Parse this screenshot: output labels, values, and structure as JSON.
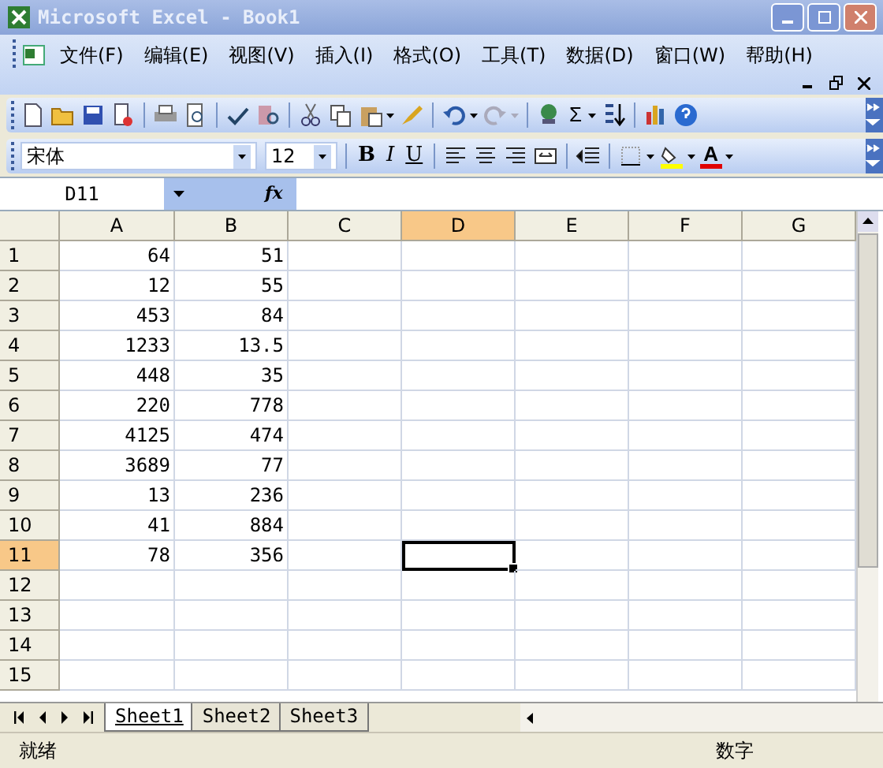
{
  "window": {
    "title": "Microsoft Excel - Book1"
  },
  "menu": [
    "文件(F)",
    "编辑(E)",
    "视图(V)",
    "插入(I)",
    "格式(O)",
    "工具(T)",
    "数据(D)",
    "窗口(W)",
    "帮助(H)"
  ],
  "toolbar": {
    "autosum": "Σ"
  },
  "format_toolbar": {
    "font": "宋体",
    "size": "12",
    "bold": "B",
    "italic": "I",
    "underline": "U",
    "font_color": "A"
  },
  "formula_bar": {
    "name_box": "D11",
    "fx": "fx"
  },
  "sheet": {
    "columns": [
      {
        "label": "A",
        "selected": false
      },
      {
        "label": "B",
        "selected": false
      },
      {
        "label": "C",
        "selected": false
      },
      {
        "label": "D",
        "selected": true
      },
      {
        "label": "E",
        "selected": false
      },
      {
        "label": "F",
        "selected": false
      },
      {
        "label": "G",
        "selected": false
      }
    ],
    "rows": [
      {
        "label": "1",
        "selected": false,
        "cells": [
          "64",
          "51"
        ]
      },
      {
        "label": "2",
        "selected": false,
        "cells": [
          "12",
          "55"
        ]
      },
      {
        "label": "3",
        "selected": false,
        "cells": [
          "453",
          "84"
        ]
      },
      {
        "label": "4",
        "selected": false,
        "cells": [
          "1233",
          "13.5"
        ]
      },
      {
        "label": "5",
        "selected": false,
        "cells": [
          "448",
          "35"
        ]
      },
      {
        "label": "6",
        "selected": false,
        "cells": [
          "220",
          "778"
        ]
      },
      {
        "label": "7",
        "selected": false,
        "cells": [
          "4125",
          "474"
        ]
      },
      {
        "label": "8",
        "selected": false,
        "cells": [
          "3689",
          "77"
        ]
      },
      {
        "label": "9",
        "selected": false,
        "cells": [
          "13",
          "236"
        ]
      },
      {
        "label": "10",
        "selected": false,
        "cells": [
          "41",
          "884"
        ]
      },
      {
        "label": "11",
        "selected": true,
        "cells": [
          "78",
          "356"
        ]
      },
      {
        "label": "12",
        "selected": false,
        "cells": []
      },
      {
        "label": "13",
        "selected": false,
        "cells": []
      },
      {
        "label": "14",
        "selected": false,
        "cells": []
      },
      {
        "label": "15",
        "selected": false,
        "cells": []
      }
    ]
  },
  "sheet_tabs": [
    {
      "label": "Sheet1",
      "selected": true
    },
    {
      "label": "Sheet2",
      "selected": false
    },
    {
      "label": "Sheet3",
      "selected": false
    }
  ],
  "status_bar": {
    "status": "就绪",
    "mode": "数字"
  }
}
